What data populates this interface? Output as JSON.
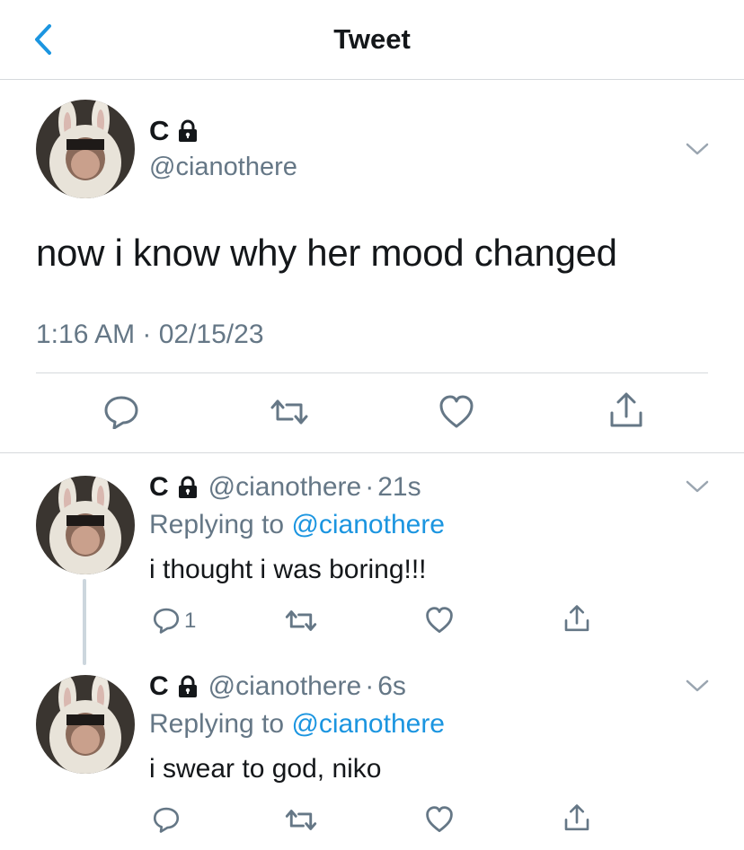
{
  "header": {
    "title": "Tweet"
  },
  "tweet": {
    "name": "C",
    "handle": "@cianothere",
    "text": "now i know why her mood changed",
    "timestamp": "1:16 AM · 02/15/23"
  },
  "replies": [
    {
      "name": "C",
      "handle": "@cianothere",
      "dot": "·",
      "time": "21s",
      "replying_prefix": "Replying to",
      "replying_to": "@cianothere",
      "text": "i thought i was boring!!!",
      "reply_count": "1"
    },
    {
      "name": "C",
      "handle": "@cianothere",
      "dot": "·",
      "time": "6s",
      "replying_prefix": "Replying to",
      "replying_to": "@cianothere",
      "text": "i swear to god, niko"
    }
  ],
  "icons": {
    "back": "chevron-left-icon",
    "lock": "lock-icon",
    "more": "chevron-down-icon",
    "reply": "reply-icon",
    "retweet": "retweet-icon",
    "like": "heart-icon",
    "share": "share-icon"
  },
  "colors": {
    "accent": "#1b95e0",
    "secondary_text": "#657786",
    "icon": "#657786",
    "divider": "#d6d9dc"
  }
}
